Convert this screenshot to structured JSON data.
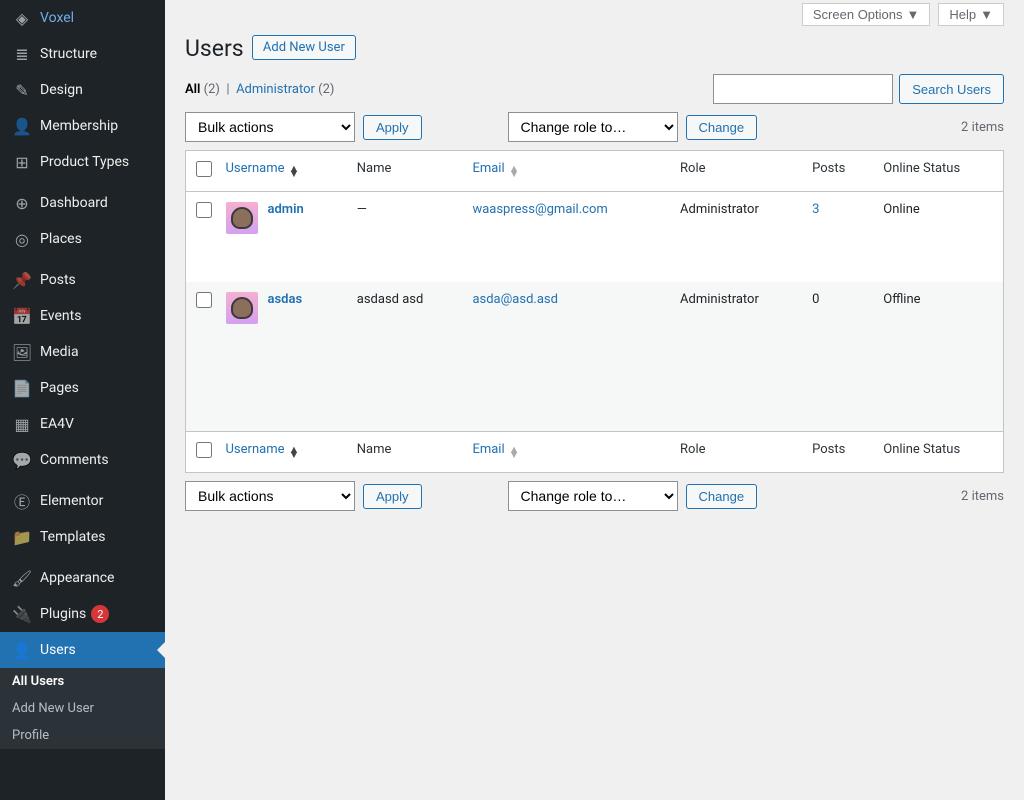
{
  "sidebar": {
    "groups": [
      [
        {
          "icon": "◈",
          "label": "Voxel"
        },
        {
          "icon": "≣",
          "label": "Structure"
        },
        {
          "icon": "✎",
          "label": "Design"
        },
        {
          "icon": "👤",
          "label": "Membership"
        },
        {
          "icon": "⊞",
          "label": "Product Types"
        }
      ],
      [
        {
          "icon": "⊕",
          "label": "Dashboard"
        },
        {
          "icon": "◎",
          "label": "Places"
        }
      ],
      [
        {
          "icon": "📌",
          "label": "Posts"
        },
        {
          "icon": "📅",
          "label": "Events"
        },
        {
          "icon": "🖼",
          "label": "Media"
        },
        {
          "icon": "📄",
          "label": "Pages"
        },
        {
          "icon": "▦",
          "label": "EA4V"
        },
        {
          "icon": "💬",
          "label": "Comments"
        }
      ],
      [
        {
          "icon": "Ⓔ",
          "label": "Elementor"
        },
        {
          "icon": "📁",
          "label": "Templates"
        }
      ],
      [
        {
          "icon": "🖌",
          "label": "Appearance"
        },
        {
          "icon": "🔌",
          "label": "Plugins",
          "badge": "2"
        },
        {
          "icon": "👤",
          "label": "Users",
          "active": true
        }
      ]
    ],
    "submenu": [
      {
        "label": "All Users",
        "active": true
      },
      {
        "label": "Add New User"
      },
      {
        "label": "Profile"
      }
    ]
  },
  "topbar": {
    "screen_options": "Screen Options",
    "help": "Help"
  },
  "header": {
    "title": "Users",
    "add_btn": "Add New User"
  },
  "filters": {
    "all_label": "All",
    "all_count": "(2)",
    "sep": "|",
    "admin_label": "Administrator",
    "admin_count": "(2)"
  },
  "search": {
    "btn": "Search Users"
  },
  "bulk": {
    "select": "Bulk actions",
    "apply": "Apply",
    "role_select": "Change role to…",
    "change": "Change"
  },
  "items_count": "2 items",
  "cols": {
    "username": "Username",
    "name": "Name",
    "email": "Email",
    "role": "Role",
    "posts": "Posts",
    "online": "Online Status"
  },
  "rows": [
    {
      "username": "admin",
      "name": "—",
      "email": "waaspress@gmail.com",
      "role": "Administrator",
      "posts": "3",
      "posts_link": true,
      "online": "Online"
    },
    {
      "username": "asdas",
      "name": "asdasd asd",
      "email": "asda@asd.asd",
      "role": "Administrator",
      "posts": "0",
      "online": "Offline"
    }
  ]
}
